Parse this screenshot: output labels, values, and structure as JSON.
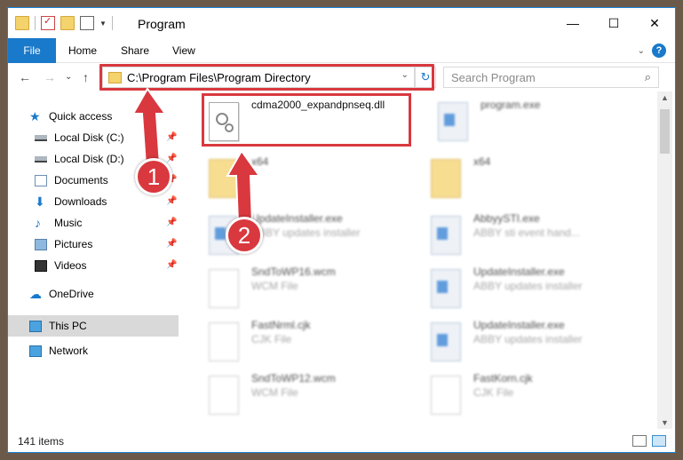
{
  "window": {
    "title": "Program",
    "controls": {
      "minimize": "—",
      "maximize": "☐",
      "close": "✕"
    }
  },
  "ribbon": {
    "file_tab": "File",
    "tabs": [
      "Home",
      "Share",
      "View"
    ],
    "help": "?"
  },
  "address": {
    "path": "C:\\Program Files\\Program Directory",
    "refresh_icon": "↻",
    "search_placeholder": "Search Program",
    "search_icon": "⌕"
  },
  "nav": {
    "back": "←",
    "forward": "→",
    "recent": "⌄",
    "up": "↑"
  },
  "sidebar": {
    "items": [
      {
        "label": "Quick access",
        "icon": "star-icon",
        "pinned": false
      },
      {
        "label": "Local Disk (C:)",
        "icon": "drive-icon",
        "pinned": true
      },
      {
        "label": "Local Disk (D:)",
        "icon": "drive-icon",
        "pinned": true
      },
      {
        "label": "Documents",
        "icon": "documents-icon",
        "pinned": true
      },
      {
        "label": "Downloads",
        "icon": "downloads-icon",
        "pinned": true
      },
      {
        "label": "Music",
        "icon": "music-icon",
        "pinned": true
      },
      {
        "label": "Pictures",
        "icon": "pictures-icon",
        "pinned": true
      },
      {
        "label": "Videos",
        "icon": "videos-icon",
        "pinned": true
      },
      {
        "label": "OneDrive",
        "icon": "onedrive-icon",
        "pinned": false
      },
      {
        "label": "This PC",
        "icon": "pc-icon",
        "pinned": false,
        "selected": true
      },
      {
        "label": "Network",
        "icon": "network-icon",
        "pinned": false
      }
    ]
  },
  "files": [
    {
      "name": "cdma2000_expandpnseq.dll",
      "type": "",
      "icon": "dll-icon",
      "highlighted": true
    },
    {
      "name": "program.exe",
      "type": "",
      "icon": "exe-icon"
    },
    {
      "name": "x64",
      "type": "",
      "icon": "folder-icon"
    },
    {
      "name": "x64",
      "type": "",
      "icon": "folder-icon"
    },
    {
      "name": "UpdateInstaller.exe",
      "type": "ABBY updates installer",
      "icon": "exe-icon"
    },
    {
      "name": "AbbyySTI.exe",
      "type": "ABBY sti event hand...",
      "icon": "exe-icon"
    },
    {
      "name": "SndToWP16.wcm",
      "type": "WCM File",
      "icon": "file-icon"
    },
    {
      "name": "UpdateInstaller.exe",
      "type": "ABBY updates installer",
      "icon": "exe-icon"
    },
    {
      "name": "FastNrml.cjk",
      "type": "CJK File",
      "icon": "file-icon"
    },
    {
      "name": "UpdateInstaller.exe",
      "type": "ABBY updates installer",
      "icon": "exe-icon"
    },
    {
      "name": "SndToWP12.wcm",
      "type": "WCM File",
      "icon": "file-icon"
    },
    {
      "name": "FastKorn.cjk",
      "type": "CJK File",
      "icon": "file-icon"
    }
  ],
  "status": {
    "count": "141 items"
  },
  "annotations": {
    "step1": "1",
    "step2": "2",
    "highlight_color": "#d9383f"
  }
}
